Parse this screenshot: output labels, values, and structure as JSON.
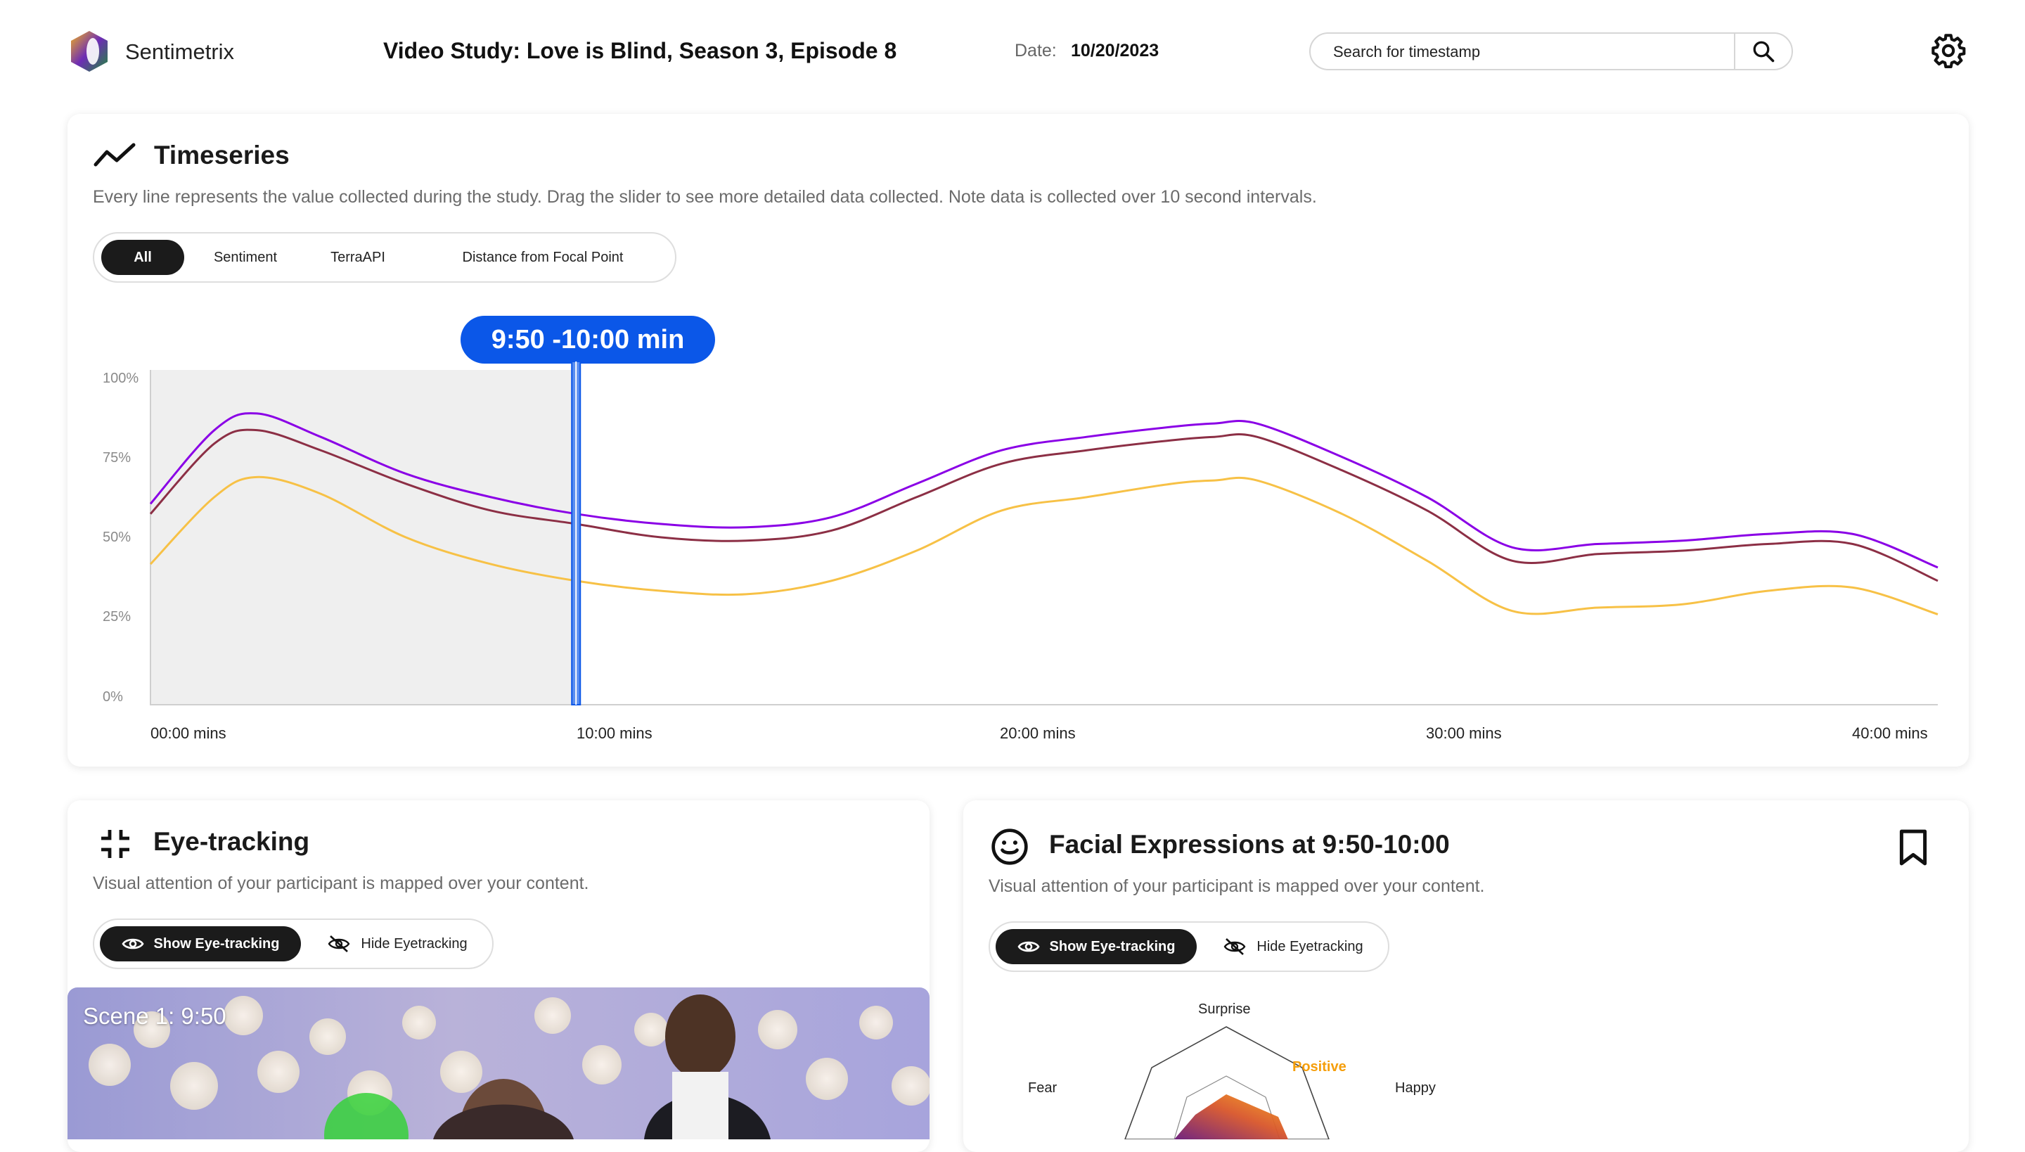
{
  "header": {
    "brand": "Sentimetrix",
    "study_title": "Video Study: Love is Blind, Season 3, Episode 8",
    "date_label": "Date:",
    "date_value": "10/20/2023",
    "search_placeholder": "Search for timestamp",
    "icons": [
      "search-icon",
      "gear-icon"
    ]
  },
  "timeseries": {
    "title": "Timeseries",
    "description": "Every line represents the value collected during the study. Drag the slider to see more detailed data collected. Note data is collected over 10 second intervals.",
    "filters": [
      "All",
      "Sentiment",
      "TerraAPI",
      "Distance from Focal Point"
    ],
    "active_filter": "All",
    "slider_label": "9:50 -10:00 min",
    "colors": {
      "purple": "#8a00e6",
      "maroon": "#8c2f45",
      "yellow": "#f7c146",
      "slider": "#0b57e8"
    }
  },
  "chart_data": {
    "type": "line",
    "yticks": [
      "100%",
      "75%",
      "50%",
      "25%",
      "0%"
    ],
    "xticks": [
      "00:00 mins",
      "10:00 mins",
      "20:00 mins",
      "30:00 mins",
      "40:00 mins"
    ],
    "x_range_min": [
      0,
      42
    ],
    "y_range_pct": [
      0,
      100
    ],
    "slider_position_min": 10,
    "series": [
      {
        "color": "#8a00e6",
        "x": [
          0,
          1.5,
          2.5,
          4,
          6,
          8,
          10,
          12,
          14,
          16,
          18,
          20,
          22,
          24,
          25,
          26,
          28,
          30,
          32,
          34,
          36,
          38,
          40,
          42
        ],
        "y": [
          60,
          82,
          87,
          80,
          69,
          62,
          57,
          54,
          53,
          56,
          66,
          76,
          80,
          83,
          84,
          84,
          74,
          62,
          47,
          48,
          49,
          51,
          51,
          41
        ]
      },
      {
        "color": "#8c2f45",
        "x": [
          0,
          1.5,
          2.5,
          4,
          6,
          8,
          10,
          12,
          14,
          16,
          18,
          20,
          22,
          24,
          25,
          26,
          28,
          30,
          32,
          34,
          36,
          38,
          40,
          42
        ],
        "y": [
          57,
          78,
          82,
          76,
          66,
          58,
          54,
          50,
          49,
          52,
          62,
          72,
          76,
          79,
          80,
          80,
          70,
          58,
          43,
          45,
          46,
          48,
          48,
          37
        ]
      },
      {
        "color": "#f7c146",
        "x": [
          0,
          1.5,
          2.5,
          4,
          6,
          8,
          10,
          12,
          14,
          16,
          18,
          20,
          22,
          24,
          25,
          26,
          28,
          30,
          32,
          34,
          36,
          38,
          40,
          42
        ],
        "y": [
          42,
          62,
          68,
          63,
          50,
          42,
          37,
          34,
          33,
          37,
          46,
          58,
          62,
          66,
          67,
          67,
          57,
          43,
          28,
          29,
          30,
          34,
          35,
          27
        ]
      }
    ]
  },
  "eyetracking": {
    "title": "Eye-tracking",
    "description": "Visual attention of your participant is mapped over your content.",
    "show_label": "Show Eye-tracking",
    "hide_label": "Hide Eyetracking",
    "scene_label": "Scene 1: 9:50"
  },
  "facial": {
    "title": "Facial Expressions at 9:50-10:00",
    "description": "Visual attention of your participant is mapped over your content.",
    "show_label": "Show Eye-tracking",
    "hide_label": "Hide Eyetracking",
    "radar_labels": {
      "top": "Surprise",
      "left": "Fear",
      "right": "Happy",
      "accent": "Positive"
    },
    "accent_color": "#f59e0b"
  }
}
